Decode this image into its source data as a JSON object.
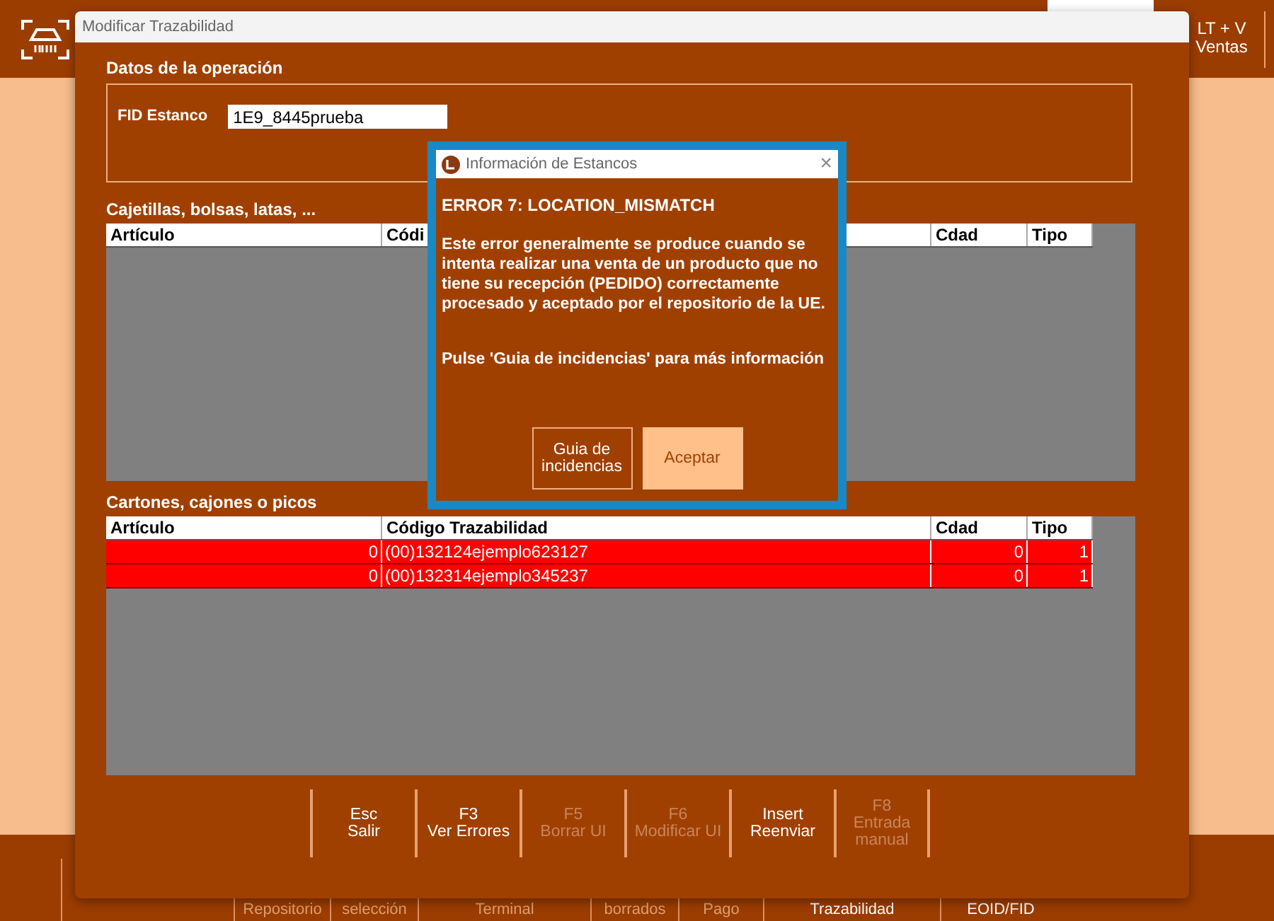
{
  "app_header": {
    "button_lines": [
      "LT + V",
      "Ventas"
    ]
  },
  "app_footer": {
    "items": [
      {
        "label": "Repositorio",
        "disabled": true
      },
      {
        "label": "selección",
        "disabled": true
      },
      {
        "label": "Terminal",
        "disabled": true
      },
      {
        "label": "borrados",
        "disabled": true
      },
      {
        "label": "Pago",
        "disabled": true
      },
      {
        "label": "Trazabilidad",
        "disabled": false
      },
      {
        "label": "EOID/FID",
        "disabled": false
      }
    ]
  },
  "window": {
    "title": "Modificar Trazabilidad",
    "operation": {
      "title": "Datos de la operación",
      "fid_label": "FID Estanco",
      "fid_value": "1E9_8445prueba"
    },
    "packs": {
      "title": "Cajetillas, bolsas, latas, ...",
      "columns": [
        "Artículo",
        "Códi",
        "Cdad",
        "Tipo"
      ]
    },
    "cartons": {
      "title": "Cartones, cajones o picos",
      "columns": [
        "Artículo",
        "Código Trazabilidad",
        "Cdad",
        "Tipo"
      ],
      "rows": [
        {
          "cells": [
            "0",
            "(00)132124ejemplo623127",
            "0",
            "1"
          ],
          "error": true
        },
        {
          "cells": [
            "0",
            "(00)132314ejemplo345237",
            "0",
            "1"
          ],
          "error": true
        }
      ]
    },
    "toolbar": [
      {
        "key": "Esc",
        "label": "Salir",
        "disabled": false
      },
      {
        "key": "F3",
        "label": "Ver Errores",
        "disabled": false
      },
      {
        "key": "F5",
        "label": "Borrar UI",
        "disabled": true
      },
      {
        "key": "F6",
        "label": "Modificar UI",
        "disabled": true
      },
      {
        "key": "Insert",
        "label": "Reenviar",
        "disabled": false
      },
      {
        "key": "F8",
        "label": "Entrada manual",
        "disabled": true
      }
    ]
  },
  "dialog": {
    "title": "Información de Estancos",
    "close": "×",
    "heading": "ERROR 7: LOCATION_MISMATCH",
    "message": "Este error generalmente se produce cuando se intenta realizar una venta de un producto que no tiene  su recepción (PEDIDO) correctamente procesado y aceptado por el repositorio de la UE.",
    "hint": "Pulse 'Guia de incidencias' para más información",
    "buttons": [
      {
        "label": "Guia de incidencias",
        "kind": "outline"
      },
      {
        "label": "Aceptar",
        "kind": "primary"
      }
    ]
  }
}
